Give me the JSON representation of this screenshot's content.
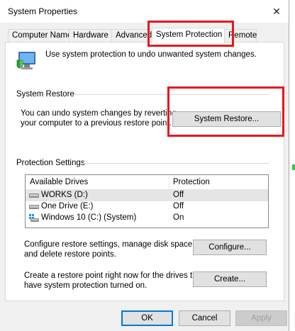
{
  "window": {
    "title": "System Properties",
    "close_glyph": "✕"
  },
  "tabs": [
    {
      "label": "Computer Name",
      "active": false
    },
    {
      "label": "Hardware",
      "active": false
    },
    {
      "label": "Advanced",
      "active": false
    },
    {
      "label": "System Protection",
      "active": true
    },
    {
      "label": "Remote",
      "active": false
    }
  ],
  "intro": {
    "text": "Use system protection to undo unwanted system changes.",
    "icon": "system-shield-icon"
  },
  "system_restore": {
    "group_label": "System Restore",
    "description_line1": "You can undo system changes by reverting",
    "description_line2": "your computer to a previous restore point.",
    "button_label": "System Restore..."
  },
  "protection_settings": {
    "group_label": "Protection Settings",
    "columns": [
      "Available Drives",
      "Protection"
    ],
    "drives": [
      {
        "name": "WORKS (D:)",
        "protection": "Off",
        "icon": "hard-drive-icon",
        "selected": true
      },
      {
        "name": "One Drive (E:)",
        "protection": "Off",
        "icon": "hard-drive-icon",
        "selected": false
      },
      {
        "name": "Windows 10 (C:) (System)",
        "protection": "On",
        "icon": "system-drive-icon",
        "selected": false
      }
    ],
    "configure_line1": "Configure restore settings, manage disk space,",
    "configure_line2": "and delete restore points.",
    "configure_button": "Configure...",
    "create_line1": "Create a restore point right now for the drives that",
    "create_line2": "have system protection turned on.",
    "create_button": "Create..."
  },
  "footer": {
    "ok": "OK",
    "cancel": "Cancel",
    "apply": "Apply"
  },
  "colors": {
    "highlight": "#e8171b",
    "accent": "#0078d7"
  }
}
